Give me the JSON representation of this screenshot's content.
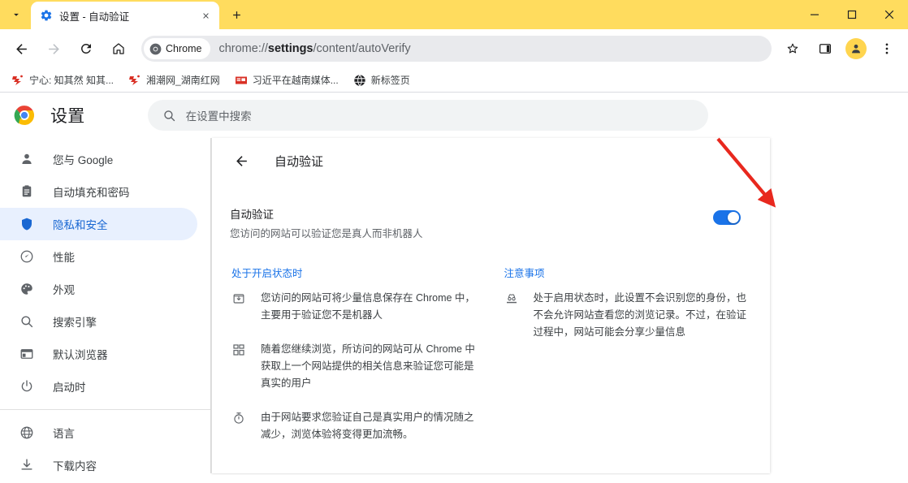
{
  "window": {
    "tab_search_icon": "chevron-down-icon",
    "minimize_label": "─",
    "maximize_label": "□",
    "close_label": "✕"
  },
  "tab": {
    "title": "设置 - 自动验证",
    "favicon": "settings-gear-icon",
    "close_icon": "close-icon",
    "new_tab_icon": "plus-icon"
  },
  "toolbar": {
    "back_icon": "back-arrow-icon",
    "forward_icon": "forward-arrow-icon",
    "reload_icon": "reload-icon",
    "home_icon": "home-icon",
    "chrome_chip_label": "Chrome",
    "url_prefix": "chrome://",
    "url_bold": "settings",
    "url_suffix": "/content/autoVerify",
    "bookmark_icon": "star-icon",
    "sidepanel_icon": "side-panel-icon",
    "avatar_icon": "person-icon",
    "menu_icon": "three-dot-menu-icon"
  },
  "bookmarks": [
    {
      "label": "宁心: 知其然 知其...",
      "icon": "red-site-icon"
    },
    {
      "label": "湘潮网_湖南红网",
      "icon": "red-site-icon"
    },
    {
      "label": "习近平在越南媒体...",
      "icon": "red-badge-icon"
    },
    {
      "label": "新标签页",
      "icon": "globe-icon"
    }
  ],
  "settings_header": {
    "logo": "chrome-logo-icon",
    "title": "设置",
    "search_icon": "search-icon",
    "search_placeholder": "在设置中搜索"
  },
  "sidebar": {
    "items": [
      {
        "label": "您与 Google",
        "icon": "person-icon",
        "active": false
      },
      {
        "label": "自动填充和密码",
        "icon": "clipboard-icon",
        "active": false
      },
      {
        "label": "隐私和安全",
        "icon": "shield-icon",
        "active": true
      },
      {
        "label": "性能",
        "icon": "speedometer-icon",
        "active": false
      },
      {
        "label": "外观",
        "icon": "palette-icon",
        "active": false
      },
      {
        "label": "搜索引擎",
        "icon": "search-icon",
        "active": false
      },
      {
        "label": "默认浏览器",
        "icon": "browser-window-icon",
        "active": false
      },
      {
        "label": "启动时",
        "icon": "power-icon",
        "active": false
      }
    ],
    "items_after_divider": [
      {
        "label": "语言",
        "icon": "globe-icon",
        "active": false
      },
      {
        "label": "下载内容",
        "icon": "download-icon",
        "active": false
      }
    ]
  },
  "main": {
    "back_icon": "back-arrow-icon",
    "page_title": "自动验证",
    "setting": {
      "title": "自动验证",
      "subtitle": "您访问的网站可以验证您是真人而非机器人",
      "toggle_on": true
    },
    "left_column": {
      "heading": "处于开启状态时",
      "bullets": [
        {
          "icon": "save-box-icon",
          "text": "您访问的网站可将少量信息保存在 Chrome 中，主要用于验证您不是机器人"
        },
        {
          "icon": "dashboard-grid-icon",
          "text": "随着您继续浏览，所访问的网站可从 Chrome 中获取上一个网站提供的相关信息来验证您可能是真实的用户"
        },
        {
          "icon": "timer-icon",
          "text": "由于网站要求您验证自己是真实用户的情况随之减少，浏览体验将变得更加流畅。"
        }
      ]
    },
    "right_column": {
      "heading": "注意事项",
      "bullets": [
        {
          "icon": "privacy-mask-icon",
          "text": "处于启用状态时，此设置不会识别您的身份，也不会允许网站查看您的浏览记录。不过，在验证过程中，网站可能会分享少量信息"
        }
      ]
    }
  },
  "annotation": {
    "arrow_color": "#e8281e",
    "arrow_name": "red-pointer-arrow"
  },
  "colors": {
    "tabstrip_yellow": "#FFDC5E",
    "accent_blue": "#1a73e8",
    "active_nav_bg": "#e8f0fe",
    "active_nav_fg": "#1967d2"
  }
}
